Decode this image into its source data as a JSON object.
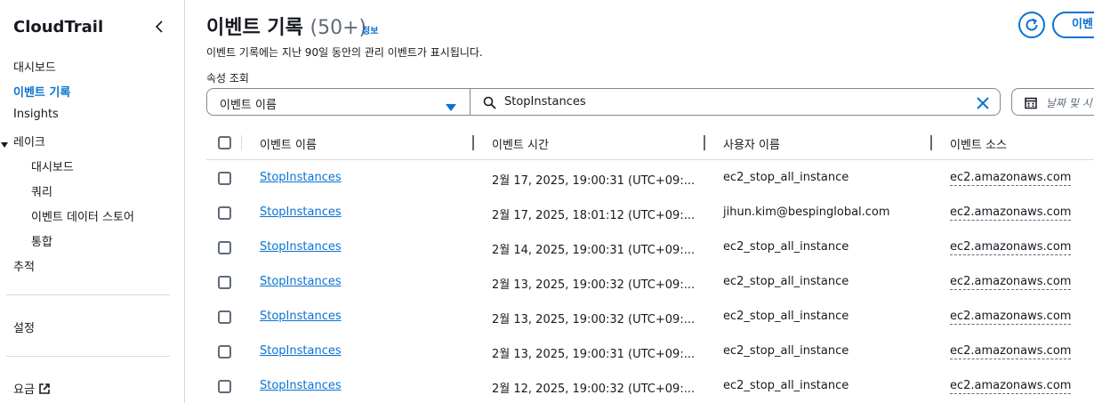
{
  "sidebar": {
    "title": "CloudTrail",
    "items": [
      {
        "label": "대시보드"
      },
      {
        "label": "이벤트 기록"
      },
      {
        "label": "Insights"
      },
      {
        "label": "레이크"
      },
      {
        "label": "대시보드"
      },
      {
        "label": "쿼리"
      },
      {
        "label": "이벤트 데이터 스토어"
      },
      {
        "label": "통합"
      },
      {
        "label": "추적"
      },
      {
        "label": "설정"
      },
      {
        "label": "요금"
      }
    ]
  },
  "header": {
    "title": "이벤트 기록",
    "count": "(50+)",
    "info": "정보",
    "description": "이벤트 기록에는 지난 90일 동안의 관리 이벤트가 표시됩니다.",
    "events_button": "이벤"
  },
  "filter": {
    "label": "속성 조회",
    "attribute": "이벤트 이름",
    "search_value": "StopInstances",
    "date_placeholder": "날짜 및 시"
  },
  "table": {
    "columns": [
      "이벤트 이름",
      "이벤트 시간",
      "사용자 이름",
      "이벤트 소스"
    ],
    "rows": [
      {
        "name": "StopInstances",
        "time": "2월 17, 2025, 19:00:31 (UTC+09:...",
        "user": "ec2_stop_all_instance",
        "source": "ec2.amazonaws.com"
      },
      {
        "name": "StopInstances",
        "time": "2월 17, 2025, 18:01:12 (UTC+09:...",
        "user": "jihun.kim@bespinglobal.com",
        "source": "ec2.amazonaws.com"
      },
      {
        "name": "StopInstances",
        "time": "2월 14, 2025, 19:00:31 (UTC+09:...",
        "user": "ec2_stop_all_instance",
        "source": "ec2.amazonaws.com"
      },
      {
        "name": "StopInstances",
        "time": "2월 13, 2025, 19:00:32 (UTC+09:...",
        "user": "ec2_stop_all_instance",
        "source": "ec2.amazonaws.com"
      },
      {
        "name": "StopInstances",
        "time": "2월 13, 2025, 19:00:32 (UTC+09:...",
        "user": "ec2_stop_all_instance",
        "source": "ec2.amazonaws.com"
      },
      {
        "name": "StopInstances",
        "time": "2월 13, 2025, 19:00:31 (UTC+09:...",
        "user": "ec2_stop_all_instance",
        "source": "ec2.amazonaws.com"
      },
      {
        "name": "StopInstances",
        "time": "2월 12, 2025, 19:00:32 (UTC+09:...",
        "user": "ec2_stop_all_instance",
        "source": "ec2.amazonaws.com"
      }
    ]
  },
  "colors": {
    "link": "#0972d3",
    "text": "#16191f",
    "border": "#7d8998"
  },
  "icons": [
    "chevron-left-icon",
    "caret-down-icon",
    "external-link-icon",
    "refresh-icon",
    "dropdown-caret-icon",
    "search-icon",
    "clear-icon",
    "calendar-icon"
  ]
}
